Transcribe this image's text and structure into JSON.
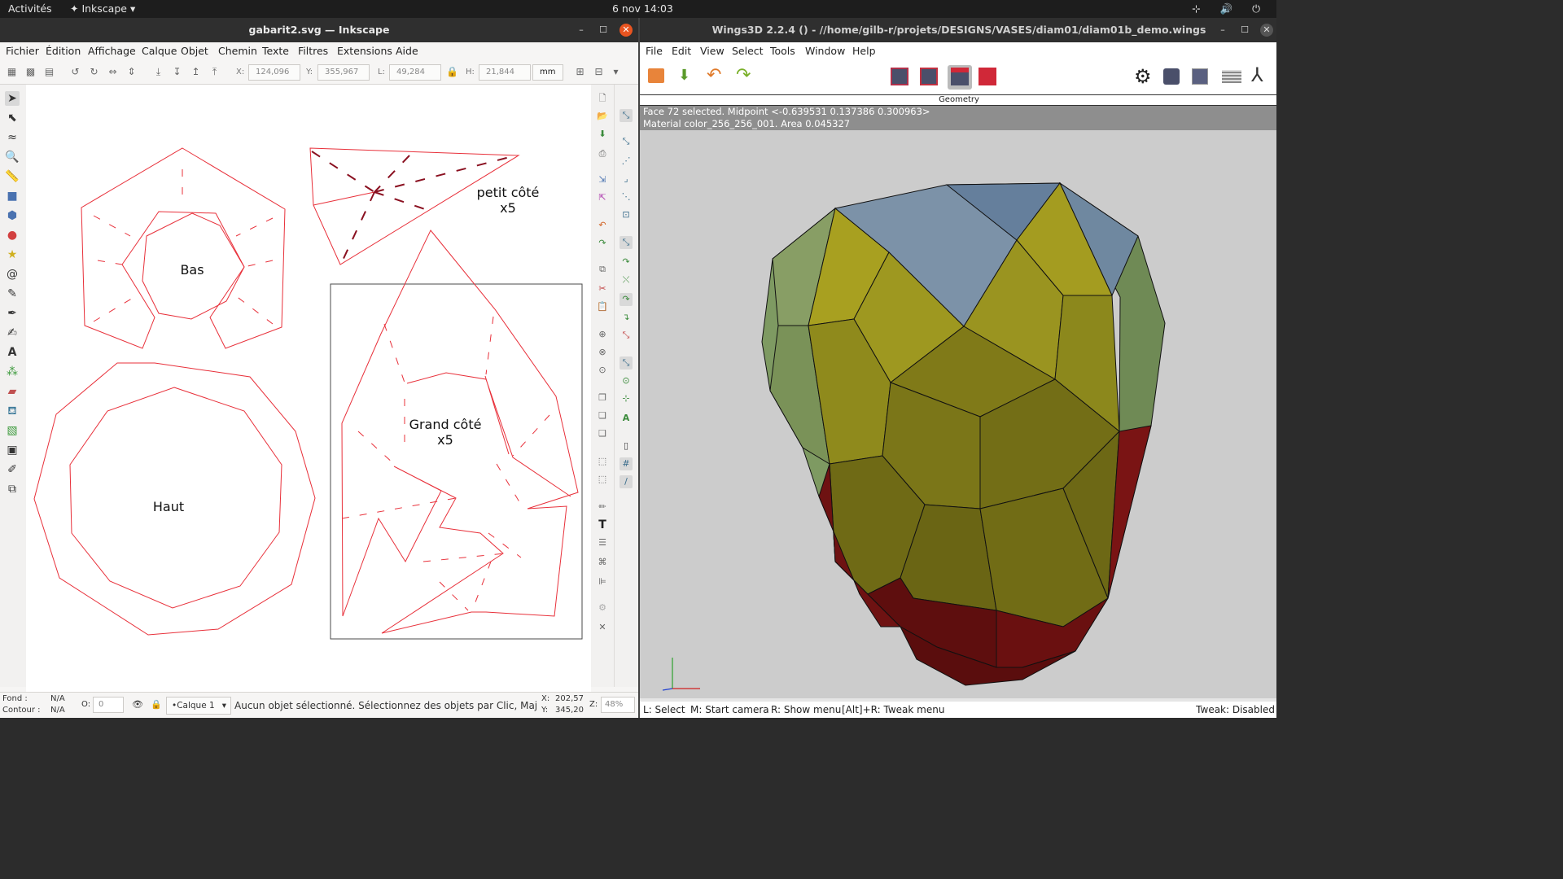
{
  "topbar": {
    "activities": "Activités",
    "app": "Inkscape",
    "clock": "6 nov  14:03",
    "tray": "⊹ 🔊 ⏻"
  },
  "inkscape": {
    "title": "gabarit2.svg — Inkscape",
    "menu": [
      "Fichier",
      "Édition",
      "Affichage",
      "Calque",
      "Objet",
      "Chemin",
      "Texte",
      "Filtres",
      "Extensions",
      "Aide"
    ],
    "controls": {
      "x_label": "X:",
      "x_value": "124,096",
      "y_label": "Y:",
      "y_value": "355,967",
      "w_label": "L:",
      "w_value": "49,284",
      "h_label": "H:",
      "h_value": "21,844",
      "unit": "mm"
    },
    "canvas": {
      "bas": "Bas",
      "petit_line1": "petit côté",
      "petit_line2": "x5",
      "grand_line1": "Grand côté",
      "grand_line2": "x5",
      "haut": "Haut"
    },
    "status": {
      "fill_label": "Fond :",
      "fill_value": "N/A",
      "stroke_label": "Contour :",
      "stroke_value": "N/A",
      "opacity_label": "O:",
      "opacity_value": "0",
      "layer": "•Calque 1",
      "message": "Aucun objet sélectionné. Sélectionnez des objets par Clic, Maj+Clic...",
      "x_label": "X:",
      "x_coord": "202,57",
      "y_label": "Y:",
      "y_coord": "345,20",
      "zoom_label": "Z:",
      "zoom": "48%"
    },
    "stroke_color": "#e8303a"
  },
  "wings": {
    "title": "Wings3D 2.2.4 () - //home/gilb-r/projets/DESIGNS/VASES/diam01/diam01b_demo.wings",
    "menu": [
      "File",
      "Edit",
      "View",
      "Select",
      "Tools",
      "Window",
      "Help"
    ],
    "geometry_label": "Geometry",
    "info_line1": "Face 72 selected. Midpoint <-0.639531  0.137386  0.300963>",
    "info_line2": "Material color_256_256_001. Area 0.045327",
    "status": {
      "select": "L: Select",
      "camera": "M: Start camera",
      "menu": "R: Show menu",
      "tweak_menu": "[Alt]+R: Tweak menu",
      "tweak": "Tweak: Disabled"
    },
    "colors": {
      "blue": "#7c92a8",
      "yellow": "#a8a020",
      "olive": "#7e9a62",
      "red": "#6e1212"
    }
  }
}
